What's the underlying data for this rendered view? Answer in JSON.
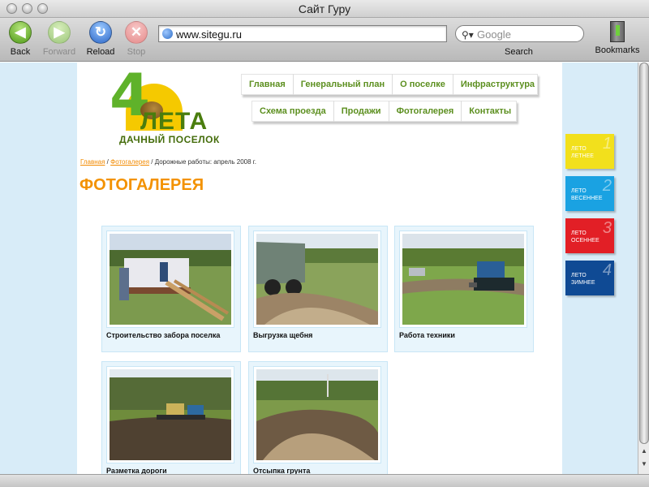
{
  "window": {
    "title": "Сайт Гуру"
  },
  "toolbar": {
    "back": "Back",
    "forward": "Forward",
    "reload": "Reload",
    "stop": "Stop",
    "url": "www.sitegu.ru",
    "search_placeholder": "Google",
    "search_label": "Search",
    "bookmarks": "Bookmarks"
  },
  "logo": {
    "digit": "4",
    "name": "ЛЕТА",
    "tagline": "ДАЧНЫЙ ПОСЕЛОК"
  },
  "menu": {
    "top": [
      "Главная",
      "Генеральный план",
      "О поселке",
      "Инфраструктура"
    ],
    "bottom": [
      "Схема проезда",
      "Продажи",
      "Фотогалерея",
      "Контакты"
    ]
  },
  "breadcrumb": {
    "home": "Главная",
    "gallery": "Фотогалерея",
    "current": "/ Дорожные работы: апрель 2008 г.",
    "sep": " / "
  },
  "page_title": "ФОТОГАЛЕРЕЯ",
  "gallery": [
    {
      "caption": "Строительство забора поселка"
    },
    {
      "caption": "Выгрузка щебня"
    },
    {
      "caption": "Работа техники"
    },
    {
      "caption": "Разметка дороги"
    },
    {
      "caption": "Отсыпка грунта"
    }
  ],
  "seasons": [
    {
      "line1": "ЛЕТО",
      "line2": "ЛЕТНЕЕ",
      "num": "1",
      "color": "#f2e01c"
    },
    {
      "line1": "ЛЕТО",
      "line2": "ВЕСЕННЕЕ",
      "num": "2",
      "color": "#1aa2e2"
    },
    {
      "line1": "ЛЕТО",
      "line2": "ОСЕННЕЕ",
      "num": "3",
      "color": "#e21f26"
    },
    {
      "line1": "ЛЕТО",
      "line2": "ЗИМНЕЕ",
      "num": "4",
      "color": "#0f4a94"
    }
  ],
  "colors": {
    "menu_text": "#5c8f1f",
    "accent_orange": "#f39200",
    "rail_blue": "#d8ecf8"
  }
}
